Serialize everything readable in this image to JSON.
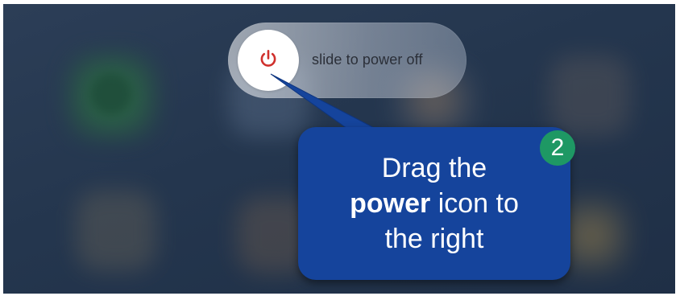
{
  "power_slider": {
    "label": "slide to power off",
    "knob_icon": "power-icon",
    "knob_icon_color": "#d0312d"
  },
  "callout": {
    "line1": "Drag the",
    "bold_word": "power",
    "line2_rest": " icon to",
    "line3": "the right",
    "background_color": "#15449c"
  },
  "step_badge": {
    "number": "2",
    "color": "#1e9864"
  }
}
